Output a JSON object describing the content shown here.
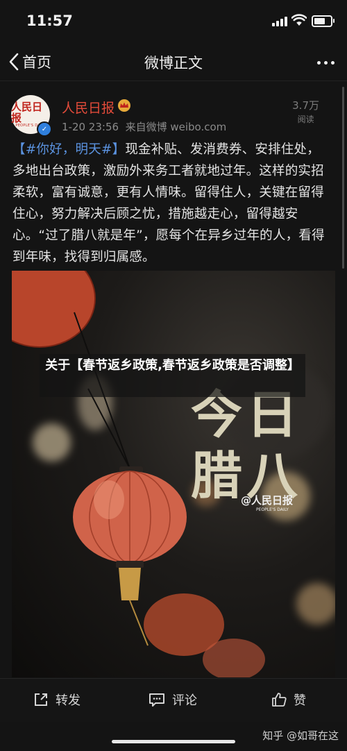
{
  "status": {
    "time": "11:57",
    "battery_level": 0.85
  },
  "nav": {
    "back_label": "首页",
    "title": "微博正文"
  },
  "post": {
    "author": "人民日报",
    "avatar_text": "人民日报",
    "avatar_subtext": "PEOPLE'S DAILY",
    "timestamp": "1-20 23:56",
    "source": "来自微博 weibo.com",
    "read_count": "3.7万",
    "read_label": "阅读",
    "hashtag": "【#你好，明天#】",
    "text": "现金补贴、发消费券、安排住处，多地出台政策，激励外来务工者就地过年。这样的实招柔软，富有诚意，更有人情味。留得住人，关键在留得住心，努力解决后顾之忧，措施越走心，留得越安心。“过了腊八就是年”，愿每个在异乡过年的人，看得到年味，找得到归属感。"
  },
  "image": {
    "line1": "今日",
    "line2": "腊八",
    "logo_text": "@人民日报",
    "logo_sub": "PEOPLE'S DAILY"
  },
  "overlay_caption": "关于【春节返乡政策,春节返乡政策是否调整】",
  "actions": {
    "repost": "转发",
    "comment": "评论",
    "like": "赞"
  },
  "watermark": "知乎 @如哥在这",
  "colors": {
    "author": "#e34b3a",
    "hashtag": "#5b93e0",
    "background": "#141414"
  }
}
